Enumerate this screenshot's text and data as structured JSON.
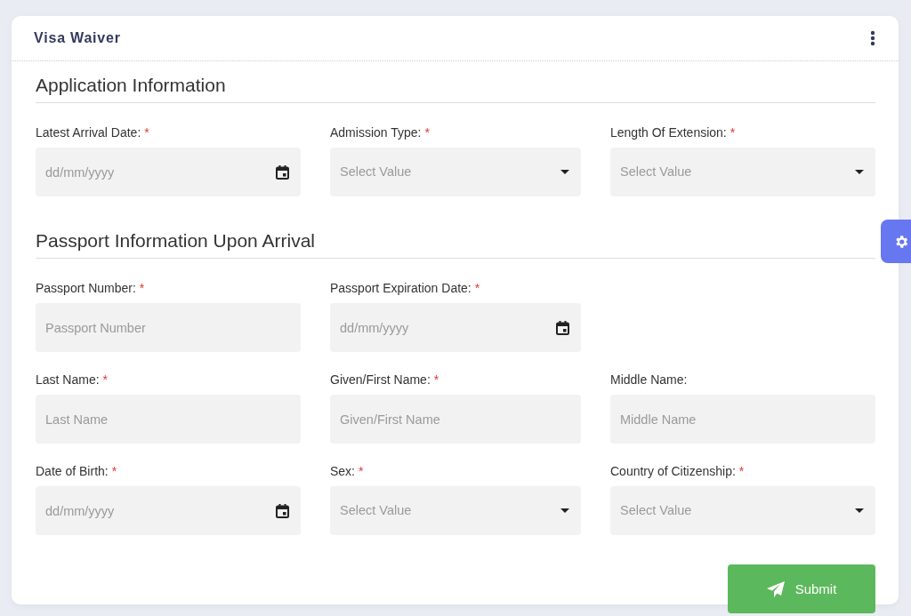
{
  "card": {
    "title": "Visa Waiver"
  },
  "sections": [
    {
      "title": "Application Information",
      "rows": [
        [
          {
            "label": "Latest Arrival Date:",
            "required_mark": "*",
            "kind": "date",
            "placeholder": "dd/mm/yyyy"
          },
          {
            "label": "Admission Type:",
            "required_mark": "*",
            "kind": "select",
            "placeholder": "Select Value"
          },
          {
            "label": "Length Of Extension:",
            "required_mark": "*",
            "kind": "select",
            "placeholder": "Select Value"
          }
        ]
      ]
    },
    {
      "title": "Passport Information Upon Arrival",
      "rows": [
        [
          {
            "label": "Passport Number:",
            "required_mark": "*",
            "kind": "text",
            "placeholder": "Passport Number"
          },
          {
            "label": "Passport Expiration Date:",
            "required_mark": "*",
            "kind": "date",
            "placeholder": "dd/mm/yyyy"
          }
        ],
        [
          {
            "label": "Last Name:",
            "required_mark": "*",
            "kind": "text",
            "placeholder": "Last Name"
          },
          {
            "label": "Given/First Name:",
            "required_mark": "*",
            "kind": "text",
            "placeholder": "Given/First Name"
          },
          {
            "label": "Middle Name:",
            "kind": "text",
            "placeholder": "Middle Name"
          }
        ],
        [
          {
            "label": "Date of Birth:",
            "required_mark": "*",
            "kind": "date",
            "placeholder": "dd/mm/yyyy"
          },
          {
            "label": "Sex:",
            "required_mark": "*",
            "kind": "select",
            "placeholder": "Select Value"
          },
          {
            "label": "Country of Citizenship:",
            "required_mark": "*",
            "kind": "select",
            "placeholder": "Select Value"
          }
        ]
      ]
    }
  ],
  "submit": {
    "label": "Submit"
  }
}
